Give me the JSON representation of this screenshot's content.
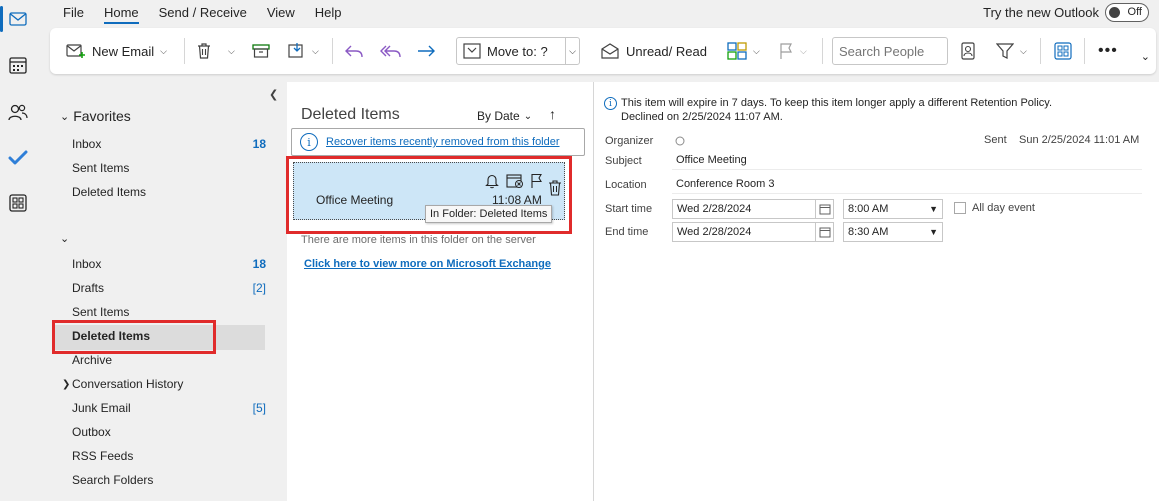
{
  "menu": {
    "items": [
      "File",
      "Home",
      "Send / Receive",
      "View",
      "Help"
    ],
    "try_new": "Try the new Outlook",
    "toggle_label": "Off"
  },
  "ribbon": {
    "new_email": "New Email",
    "move_to": "Move to: ?",
    "unread_read": "Unread/ Read",
    "search_people_placeholder": "Search People"
  },
  "folders": {
    "favorites_header": "Favorites",
    "favorites": [
      {
        "name": "Inbox",
        "count": "18"
      },
      {
        "name": "Sent Items",
        "count": ""
      },
      {
        "name": "Deleted Items",
        "count": ""
      }
    ],
    "account": [
      {
        "name": "Inbox",
        "count": "18"
      },
      {
        "name": "Drafts",
        "count": "[2]"
      },
      {
        "name": "Sent Items",
        "count": ""
      },
      {
        "name": "Deleted Items",
        "count": ""
      },
      {
        "name": "Archive",
        "count": ""
      },
      {
        "name": "Conversation History",
        "count": ""
      },
      {
        "name": "Junk Email",
        "count": "[5]"
      },
      {
        "name": "Outbox",
        "count": ""
      },
      {
        "name": "RSS Feeds",
        "count": ""
      },
      {
        "name": "Search Folders",
        "count": ""
      }
    ]
  },
  "message_list": {
    "title": "Deleted Items",
    "sort": "By Date",
    "recover_link": "Recover items recently removed from this folder",
    "item": {
      "subject": "Office Meeting",
      "time": "11:08 AM"
    },
    "tooltip": "In Folder: Deleted Items",
    "more_items": "There are more items in this folder on the server",
    "exchange_link": "Click here to view more on Microsoft Exchange"
  },
  "reading": {
    "info_line1": "This item will expire in 7 days. To keep this item longer apply a different Retention Policy.",
    "info_line2": "Declined on 2/25/2024 11:07 AM.",
    "organizer_label": "Organizer",
    "sent_label": "Sent",
    "sent_value": "Sun 2/25/2024 11:01 AM",
    "subject_label": "Subject",
    "subject_value": "Office Meeting",
    "location_label": "Location",
    "location_value": "Conference Room 3",
    "start_label": "Start time",
    "start_date": "Wed 2/28/2024",
    "start_time": "8:00 AM",
    "end_label": "End time",
    "end_date": "Wed 2/28/2024",
    "end_time": "8:30 AM",
    "all_day": "All day event"
  },
  "colors": {
    "accent": "#0f6cbd",
    "highlight": "#e02b2b",
    "selected_item": "#cde6f7"
  }
}
